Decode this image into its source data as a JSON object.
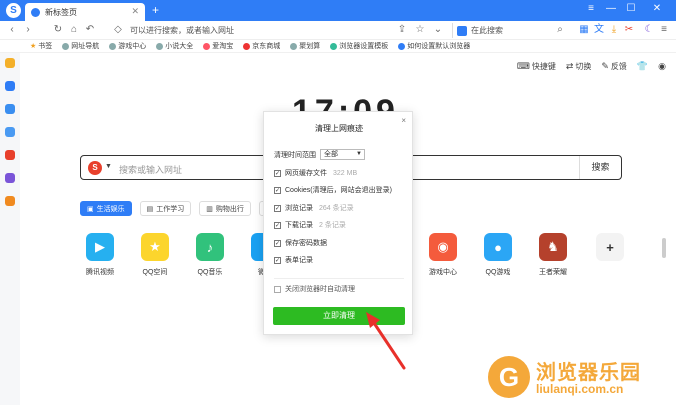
{
  "browser": {
    "tab": {
      "title": "新标签页",
      "close": "✕"
    },
    "new_tab": "+",
    "window_controls": [
      "≡",
      "—",
      "☐",
      "✕"
    ],
    "url_placeholder": "可以进行搜索，或者输入网址",
    "search_engine_label": "在此搜索",
    "accent_color": "#2f7df6"
  },
  "bookmarks": [
    "书签",
    "网址导航",
    "游戏中心",
    "小说大全",
    "爱淘宝",
    "京东商城",
    "聚划算",
    "浏览器设置模板",
    "如何设置默认浏览器"
  ],
  "page": {
    "top_tools": [
      {
        "icon": "keyboard-icon",
        "label": "快捷键"
      },
      {
        "icon": "switch-icon",
        "label": "切换"
      },
      {
        "icon": "feedback-icon",
        "label": "反馈"
      },
      {
        "icon": "shirt-icon",
        "label": ""
      },
      {
        "icon": "eye-icon",
        "label": ""
      }
    ],
    "clock": "17:09",
    "search": {
      "placeholder": "搜索或输入网址",
      "button": "搜索",
      "engine_glyph": "S"
    },
    "category_tabs": [
      "生活娱乐",
      "工作学习",
      "购物出行",
      "..."
    ],
    "apps": [
      {
        "label": "腾讯视频",
        "color": "#26b0f0",
        "glyph": "▶"
      },
      {
        "label": "QQ空间",
        "color": "#fcd52d",
        "glyph": "★"
      },
      {
        "label": "QQ音乐",
        "color": "#31c27c",
        "glyph": "♪"
      },
      {
        "label": "微博",
        "color": "#1aa1f2",
        "glyph": ""
      },
      {
        "label": "游戏中心",
        "color": "#f45b3c",
        "glyph": "◉"
      },
      {
        "label": "QQ游戏",
        "color": "#2ba6f5",
        "glyph": "●"
      },
      {
        "label": "王者荣耀",
        "color": "#b5412c",
        "glyph": "♞"
      },
      {
        "label": "",
        "color": "#f3f3f3",
        "glyph": "+"
      }
    ]
  },
  "dialog": {
    "title": "清理上网痕迹",
    "close": "×",
    "range_label": "清理时间范围",
    "range_value": "全部",
    "items": [
      {
        "label": "网页缓存文件",
        "meta": "322 MB",
        "checked": true
      },
      {
        "label": "Cookies(清理后，网站会退出登录)",
        "meta": "",
        "checked": true
      },
      {
        "label": "浏览记录",
        "meta": "264 条记录",
        "checked": true
      },
      {
        "label": "下载记录",
        "meta": "2 条记录",
        "checked": true
      },
      {
        "label": "保存密码数据",
        "meta": "",
        "checked": true
      },
      {
        "label": "表单记录",
        "meta": "",
        "checked": true
      }
    ],
    "autoclean_label": "关闭浏览器时自动清理",
    "button": "立即清理"
  },
  "watermark": {
    "title": "浏览器乐园",
    "url": "liulanqi.com.cn",
    "logo_glyph": "G"
  }
}
